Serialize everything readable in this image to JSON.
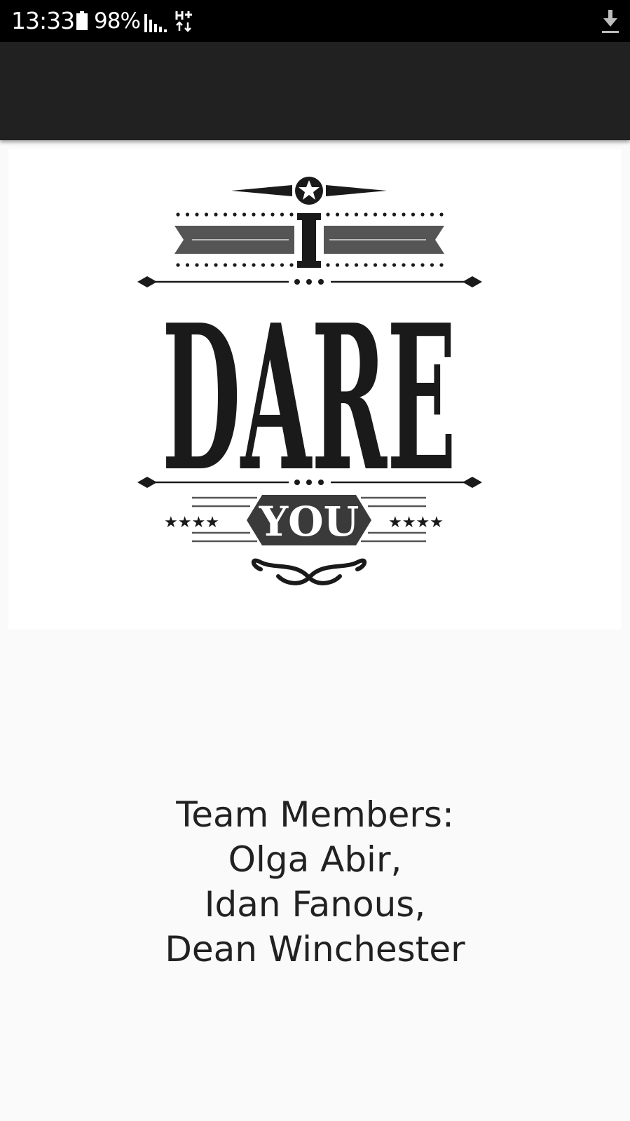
{
  "status_bar": {
    "time": "13:33",
    "battery": "98%",
    "battery_icon": "battery-icon",
    "signal_icon": "signal-icon",
    "network_icon": "network-h-plus-icon",
    "download_icon": "download-icon"
  },
  "logo": {
    "top_word": "I",
    "main_word": "DARE",
    "bottom_word": "YOU"
  },
  "team": {
    "heading": "Team Members:",
    "members": [
      "Olga Abir,",
      "Idan Fanous,",
      "Dean Winchester"
    ]
  },
  "colors": {
    "status_bar": "#000000",
    "app_bar": "#212121",
    "background": "#fafafa",
    "text": "#212121",
    "logo_ink": "#1a1a1a",
    "logo_gray": "#555555"
  }
}
